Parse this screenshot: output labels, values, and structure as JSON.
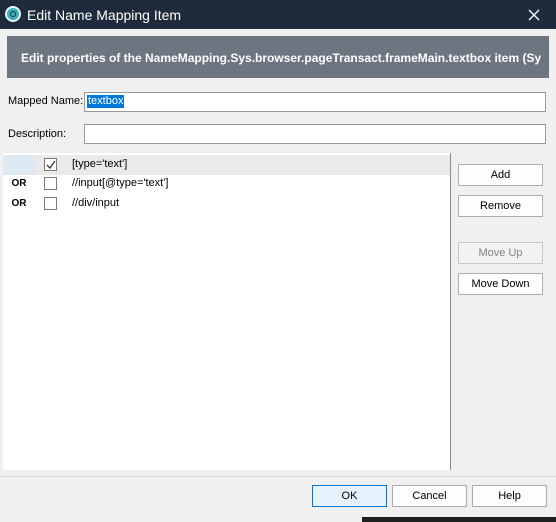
{
  "window": {
    "title": "Edit Name Mapping Item",
    "app_icon": "app-logo-icon",
    "close_icon": "close-icon"
  },
  "banner": {
    "text": "Edit properties of the NameMapping.Sys.browser.pageTransact.frameMain.textbox item (Sy"
  },
  "form": {
    "mapped_name_label": "Mapped Name:",
    "mapped_name_value": "textbox",
    "description_label": "Description:",
    "description_value": ""
  },
  "criteria": [
    {
      "operator": "",
      "checked": true,
      "value": "[type='text']"
    },
    {
      "operator": "OR",
      "checked": false,
      "value": "//input[@type='text']"
    },
    {
      "operator": "OR",
      "checked": false,
      "value": "//div/input"
    }
  ],
  "side_buttons": {
    "add": "Add",
    "remove": "Remove",
    "move_up": "Move Up",
    "move_down": "Move Down"
  },
  "footer": {
    "ok": "OK",
    "cancel": "Cancel",
    "help": "Help"
  }
}
